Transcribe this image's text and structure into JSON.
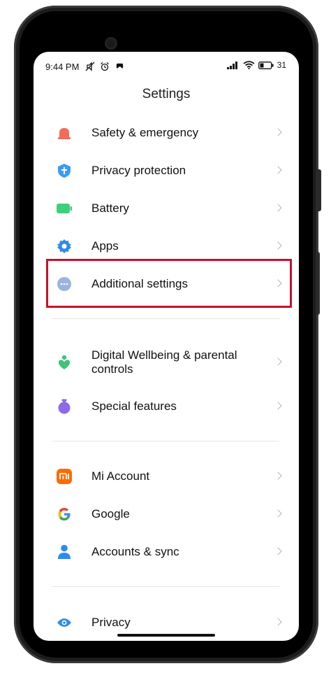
{
  "status_bar": {
    "time": "9:44 PM",
    "battery_pct": "31"
  },
  "page": {
    "title": "Settings"
  },
  "groups": [
    {
      "items": [
        {
          "label": "Safety & emergency",
          "icon": "safety-icon",
          "color": "#F26B5B"
        },
        {
          "label": "Privacy protection",
          "icon": "shield-icon",
          "color": "#3A9BF5"
        },
        {
          "label": "Battery",
          "icon": "battery-icon",
          "color": "#3DD07A"
        },
        {
          "label": "Apps",
          "icon": "gear-icon",
          "color": "#2E8BEA"
        },
        {
          "label": "Additional settings",
          "icon": "more-dots-icon",
          "color": "#9CB3E0"
        }
      ]
    },
    {
      "items": [
        {
          "label": "Digital Wellbeing & parental controls",
          "icon": "heart-person-icon",
          "color": "#3DC47A"
        },
        {
          "label": "Special features",
          "icon": "potion-icon",
          "color": "#8A6BEA"
        }
      ]
    },
    {
      "items": [
        {
          "label": "Mi Account",
          "icon": "mi-logo-icon",
          "color": "#FF6A00"
        },
        {
          "label": "Google",
          "icon": "google-g-icon",
          "color": "#4285F4"
        },
        {
          "label": "Accounts & sync",
          "icon": "person-icon",
          "color": "#2E8BEA"
        }
      ]
    },
    {
      "items": [
        {
          "label": "Privacy",
          "icon": "eye-icon",
          "color": "#2E8BEA"
        }
      ]
    }
  ],
  "highlight_color": "#C8102E"
}
